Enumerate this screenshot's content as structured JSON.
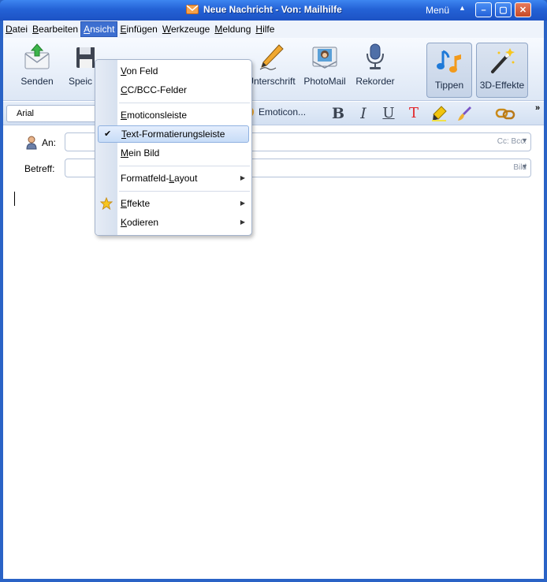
{
  "window": {
    "title": "Neue Nachricht - Von: Mailhilfe",
    "menu_label": "Menü",
    "menu_arrow": "▲",
    "minimize": "–",
    "maximize": "▢",
    "close": "✕"
  },
  "menubar": {
    "items": [
      {
        "u": "D",
        "rest": "atei"
      },
      {
        "u": "B",
        "rest": "earbeiten"
      },
      {
        "u": "A",
        "rest": "nsicht"
      },
      {
        "u": "E",
        "rest": "infügen"
      },
      {
        "u": "W",
        "rest": "erkzeuge"
      },
      {
        "u": "M",
        "rest": "eldung"
      },
      {
        "u": "H",
        "rest": "ilfe"
      }
    ],
    "active_index": 2
  },
  "toolbar": {
    "send": "Senden",
    "save": "Speic",
    "signature": "Unterschrift",
    "photomail": "PhotoMail",
    "recorder": "Rekorder",
    "tips": "Tippen",
    "effects3d": "3D-Effekte"
  },
  "formatbar": {
    "font": "Arial",
    "emoticon": "Emoticon...",
    "bold": "B",
    "italic": "I",
    "underline": "U",
    "textcolor": "T",
    "overflow": "»"
  },
  "fields": {
    "to_label": "An:",
    "to_value": "",
    "to_extra": "Cc: Bcc:",
    "subject_label": "Betreff:",
    "subject_value": "",
    "subject_extra": "Bild"
  },
  "dropdown": {
    "items": [
      {
        "u": "V",
        "rest": "on Feld",
        "checked": false,
        "submenu": false
      },
      {
        "u": "C",
        "rest": "C/BCC-Felder",
        "checked": false,
        "submenu": false
      },
      {
        "u": "E",
        "rest": "moticonsleiste",
        "checked": false,
        "submenu": false
      },
      {
        "u": "T",
        "rest": "ext-Formatierungsleiste",
        "checked": true,
        "submenu": false
      },
      {
        "u": "M",
        "rest": "ein Bild",
        "checked": false,
        "submenu": false
      },
      {
        "pre": "Formatfeld-",
        "u": "L",
        "rest": "ayout",
        "checked": false,
        "submenu": true
      },
      {
        "u": "E",
        "rest": "ffekte",
        "checked": false,
        "submenu": true
      },
      {
        "u": "K",
        "rest": "odieren",
        "checked": false,
        "submenu": true
      }
    ],
    "check_glyph": "✔",
    "submenu_glyph": "▶"
  },
  "colors": {
    "title_blue": "#2462d6",
    "menu_active": "#3d6fd0",
    "text_color_icon": "#e2262a"
  }
}
